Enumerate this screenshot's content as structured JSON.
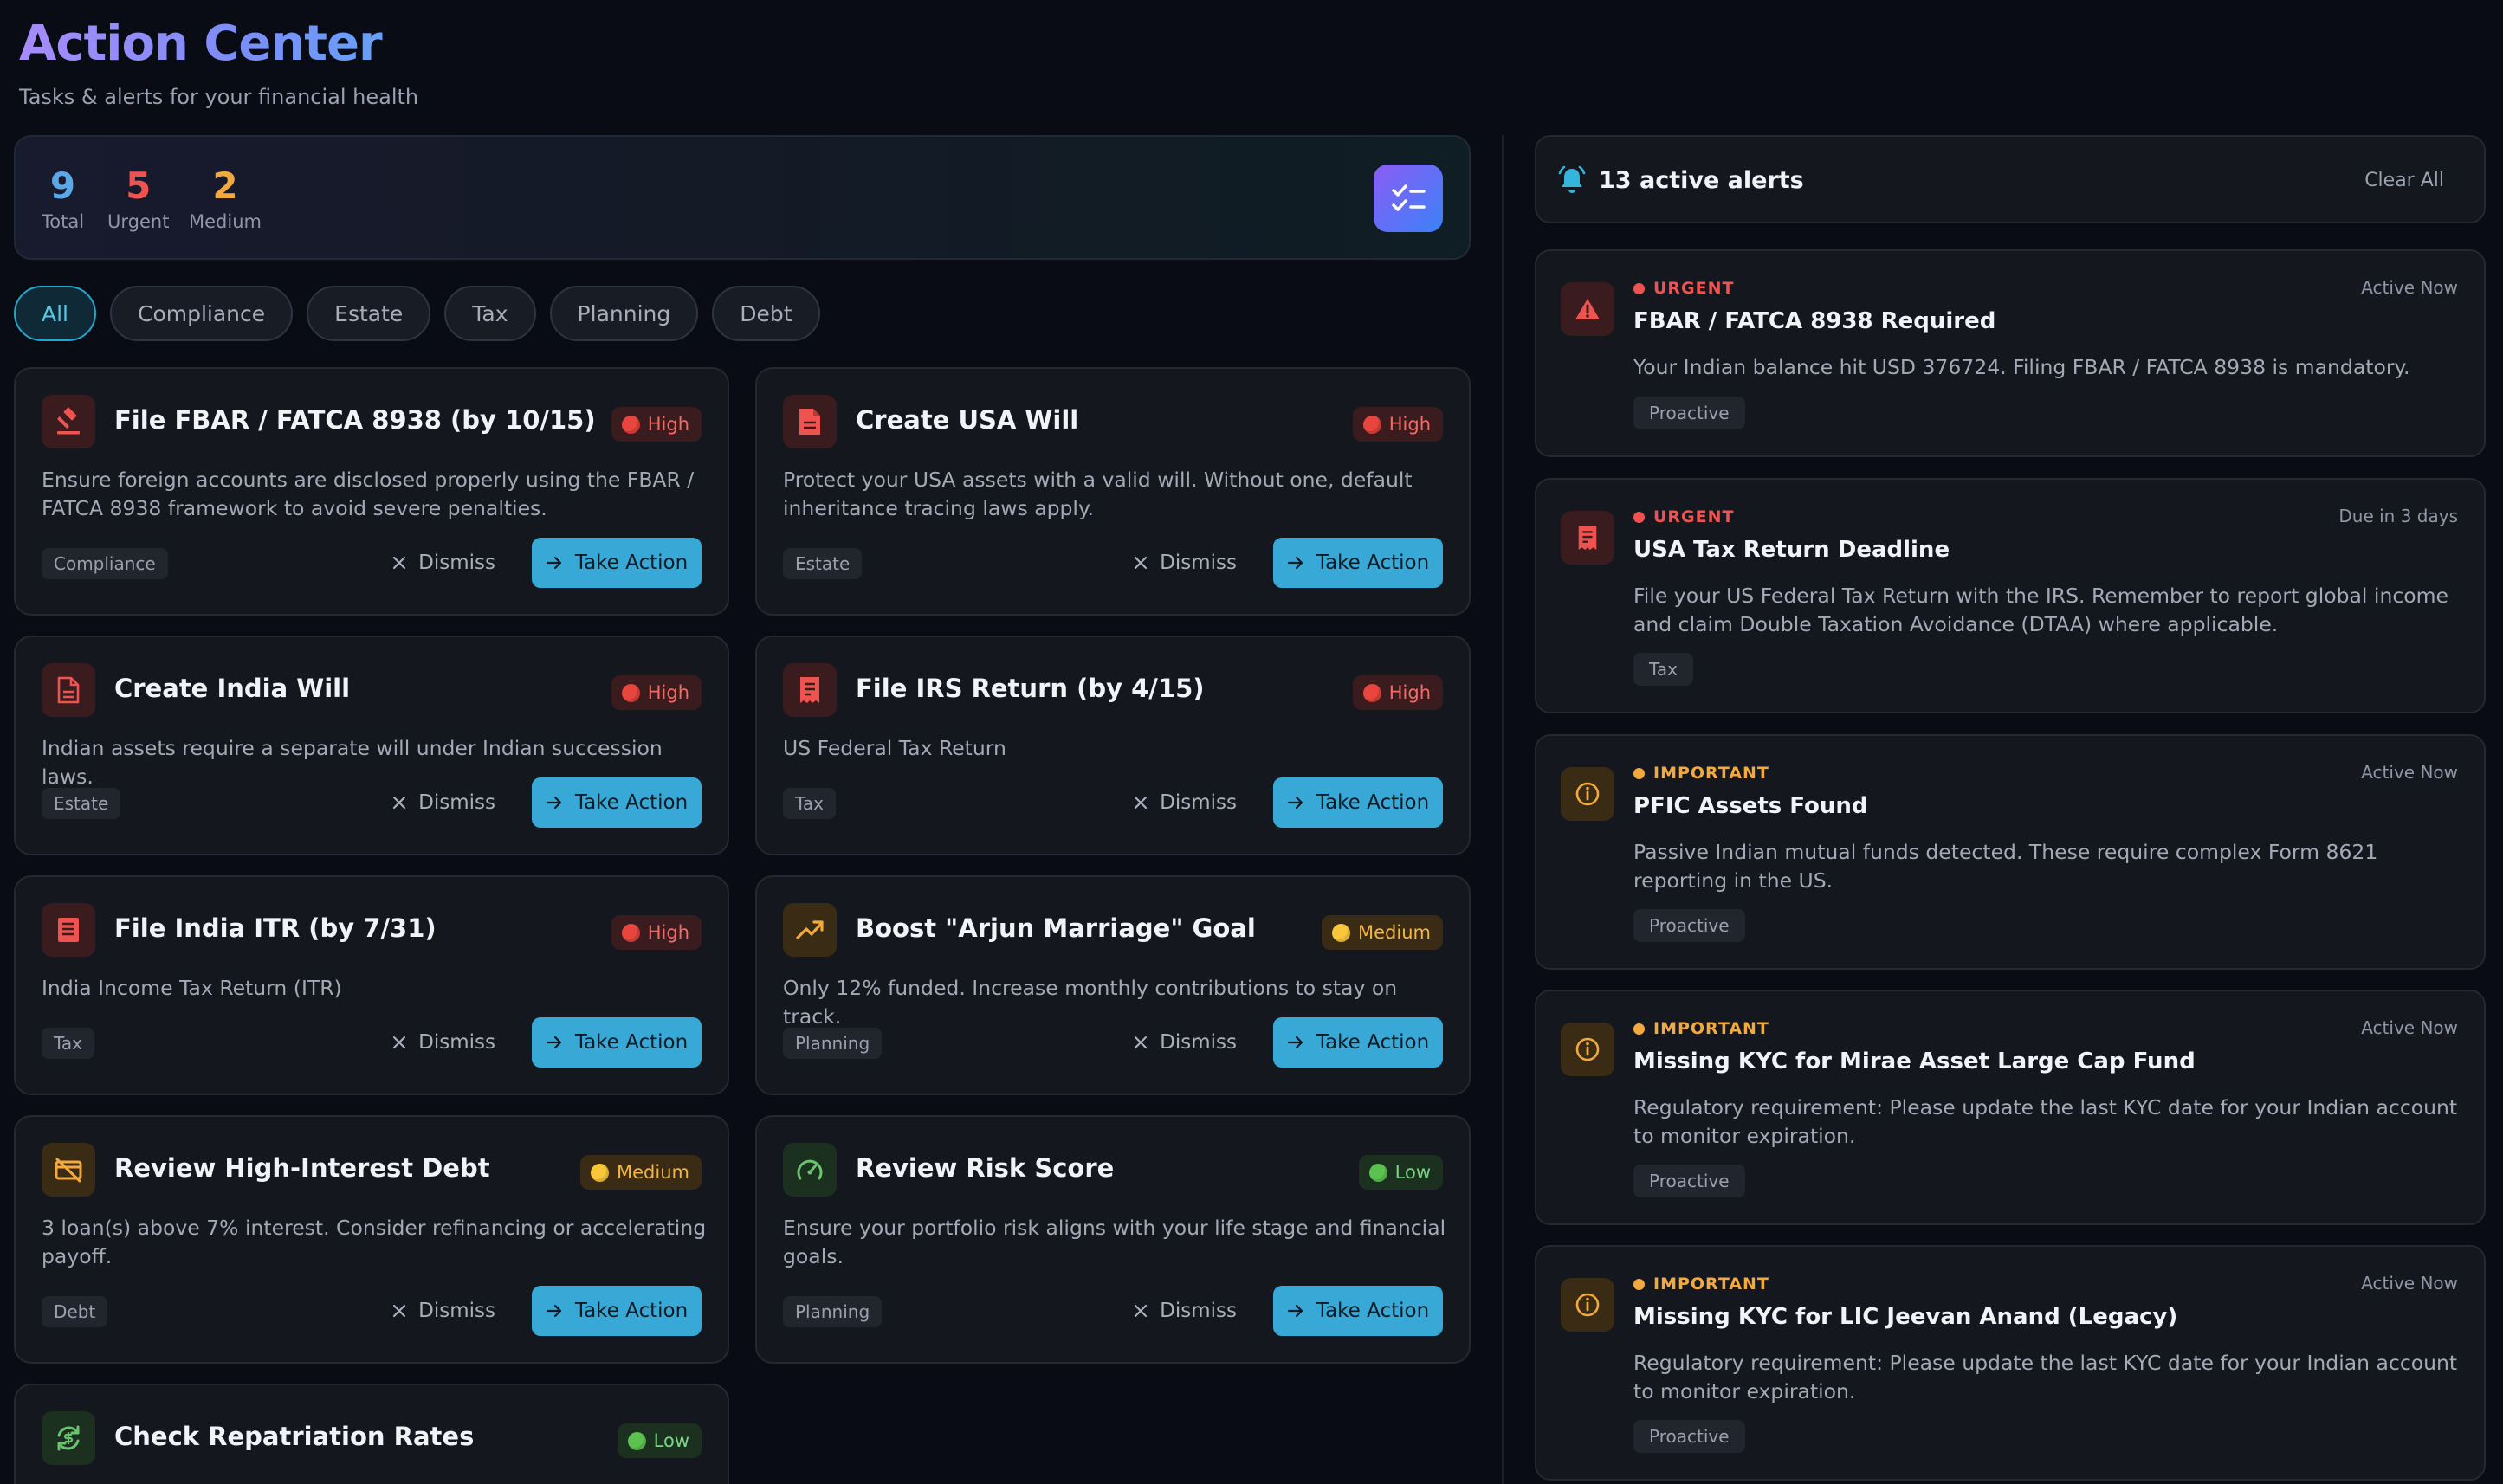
{
  "header": {
    "title": "Action Center",
    "subtitle": "Tasks & alerts for your financial health"
  },
  "stats": [
    {
      "value": "9",
      "label": "Total",
      "color": "#5aa9e6"
    },
    {
      "value": "5",
      "label": "Urgent",
      "color": "#ef5350"
    },
    {
      "value": "2",
      "label": "Medium",
      "color": "#f3a93c"
    }
  ],
  "filters": [
    "All",
    "Compliance",
    "Estate",
    "Tax",
    "Planning",
    "Debt"
  ],
  "filter_active": "All",
  "common": {
    "dismiss_label": "Dismiss",
    "action_label": "Take Action"
  },
  "tasks": [
    {
      "title": "File FBAR / FATCA 8938 (by 10/15)",
      "priority": "High",
      "description": "Ensure foreign accounts are disclosed properly using the FBAR / FATCA 8938 framework to avoid severe penalties.",
      "tag": "Compliance",
      "icon": "gavel-icon"
    },
    {
      "title": "Create USA Will",
      "priority": "High",
      "description": "Protect your USA assets with a valid will. Without one, default inheritance tracing laws apply.",
      "tag": "Estate",
      "icon": "document-icon"
    },
    {
      "title": "Create India Will",
      "priority": "High",
      "description": "Indian assets require a separate will under Indian succession laws.",
      "tag": "Estate",
      "icon": "document-outline-icon"
    },
    {
      "title": "File IRS Return (by 4/15)",
      "priority": "High",
      "description": "US Federal Tax Return",
      "tag": "Tax",
      "icon": "receipt-icon"
    },
    {
      "title": "File India ITR (by 7/31)",
      "priority": "High",
      "description": "India Income Tax Return (ITR)",
      "tag": "Tax",
      "icon": "form-icon"
    },
    {
      "title": "Boost \"Arjun Marriage\" Goal",
      "priority": "Medium",
      "description": "Only 12% funded. Increase monthly contributions to stay on track.",
      "tag": "Planning",
      "icon": "trending-up-icon"
    },
    {
      "title": "Review High-Interest Debt",
      "priority": "Medium",
      "description": "3 loan(s) above 7% interest. Consider refinancing or accelerating payoff.",
      "tag": "Debt",
      "icon": "credit-card-off-icon"
    },
    {
      "title": "Review Risk Score",
      "priority": "Low",
      "description": "Ensure your portfolio risk aligns with your life stage and financial goals.",
      "tag": "Planning",
      "icon": "gauge-icon"
    },
    {
      "title": "Check Repatriation Rates",
      "priority": "Low",
      "description": "",
      "tag": "",
      "icon": "currency-exchange-icon"
    }
  ],
  "alerts_panel": {
    "count_label": "13 active alerts",
    "clear_label": "Clear All"
  },
  "alerts": [
    {
      "severity": "URGENT",
      "when": "Active Now",
      "title": "FBAR / FATCA 8938 Required",
      "description": "Your Indian balance hit USD 376724. Filing FBAR / FATCA 8938 is mandatory.",
      "tag": "Proactive",
      "icon": "warning-icon"
    },
    {
      "severity": "URGENT",
      "when": "Due in 3 days",
      "title": "USA Tax Return Deadline",
      "description": "File your US Federal Tax Return with the IRS. Remember to report global income and claim Double Taxation Avoidance (DTAA) where applicable.",
      "tag": "Tax",
      "icon": "receipt-icon"
    },
    {
      "severity": "IMPORTANT",
      "when": "Active Now",
      "title": "PFIC Assets Found",
      "description": "Passive Indian mutual funds detected. These require complex Form 8621 reporting in the US.",
      "tag": "Proactive",
      "icon": "info-icon"
    },
    {
      "severity": "IMPORTANT",
      "when": "Active Now",
      "title": "Missing KYC for Mirae Asset Large Cap Fund",
      "description": "Regulatory requirement: Please update the last KYC date for your Indian account to monitor expiration.",
      "tag": "Proactive",
      "icon": "info-icon"
    },
    {
      "severity": "IMPORTANT",
      "when": "Active Now",
      "title": "Missing KYC for LIC Jeevan Anand (Legacy)",
      "description": "Regulatory requirement: Please update the last KYC date for your Indian account to monitor expiration.",
      "tag": "Proactive",
      "icon": "info-icon"
    }
  ]
}
